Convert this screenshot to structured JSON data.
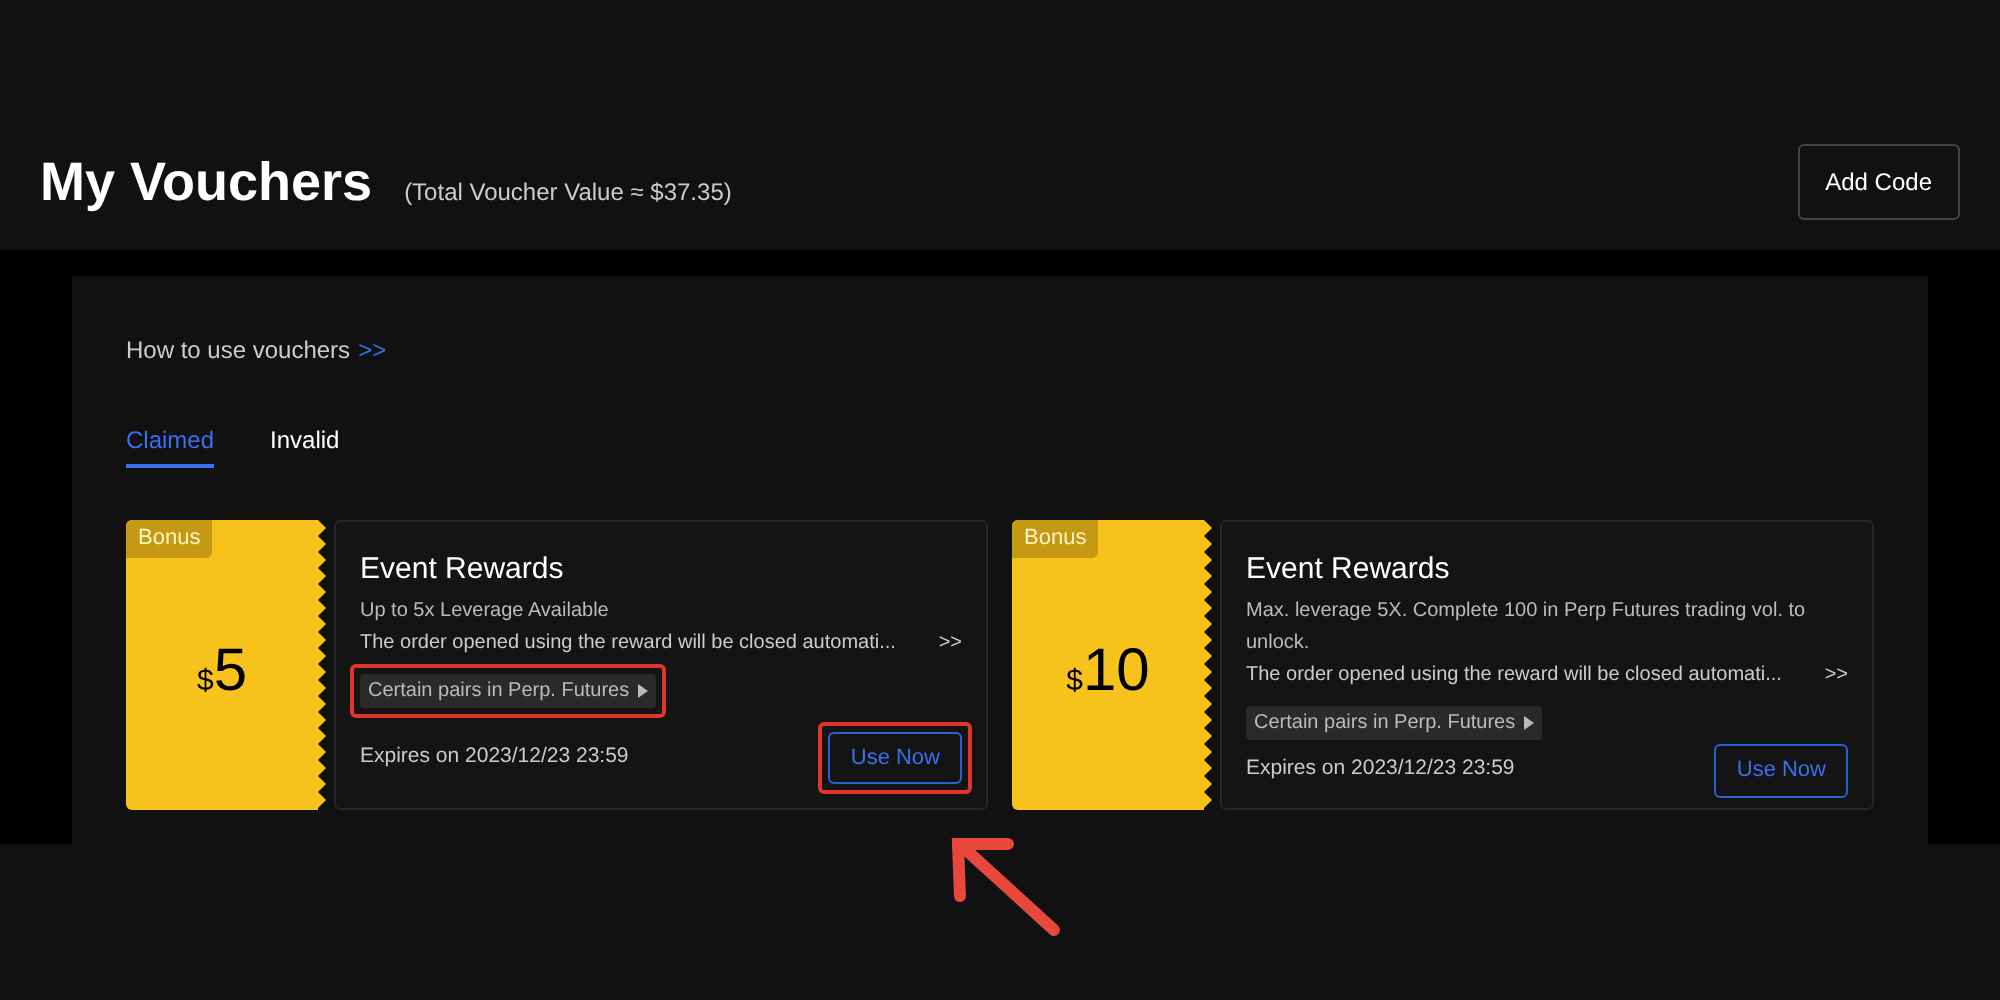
{
  "header": {
    "title": "My Vouchers",
    "total": "(Total Voucher Value ≈ $37.35)",
    "add_button": "Add Code"
  },
  "guide": {
    "text": "How to use vouchers",
    "link": ">>"
  },
  "tabs": [
    {
      "label": "Claimed",
      "selected": true
    },
    {
      "label": "Invalid",
      "selected": false
    }
  ],
  "vouchers": [
    {
      "badge": "Bonus",
      "currency": "$",
      "amount": "5",
      "title": "Event Rewards",
      "lines": [
        "Up to 5x Leverage Available"
      ],
      "notice": "The order opened using the reward will be closed automati...",
      "more": ">>",
      "tag": "Certain pairs in Perp. Futures",
      "expires": "Expires on 2023/12/23 23:59",
      "button": "Use Now",
      "tag_highlighted": true,
      "button_highlighted": true
    },
    {
      "badge": "Bonus",
      "currency": "$",
      "amount": "10",
      "title": "Event Rewards",
      "lines": [
        "Max. leverage 5X. Complete 100 in Perp Futures trading vol. to unlock."
      ],
      "notice": "The order opened using the reward will be closed automati...",
      "more": ">>",
      "tag": "Certain pairs in Perp. Futures",
      "expires": "Expires on 2023/12/23 23:59",
      "button": "Use Now",
      "tag_highlighted": false,
      "button_highlighted": false
    }
  ],
  "annotation": {
    "arrow": true
  }
}
